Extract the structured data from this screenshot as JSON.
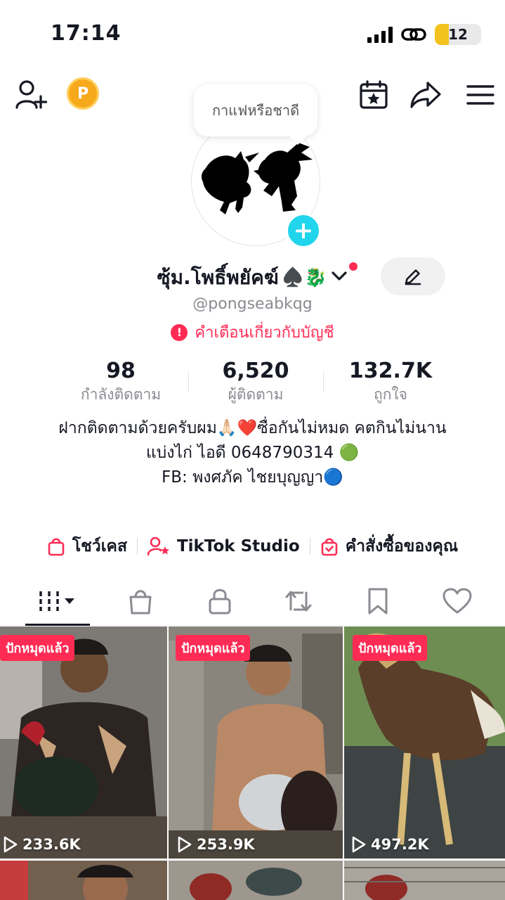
{
  "status": {
    "time": "17:14",
    "battery": "12"
  },
  "header": {
    "coin_letter": "P",
    "bubble_text": "กาแฟหรือชาดี"
  },
  "profile": {
    "display_name": "ซุ้ม.โพธิ์พยัคฆ์",
    "name_emoji": "♠️🐉",
    "username": "@pongseabkqg",
    "warning": "คำเตือนเกี่ยวกับบัญชี"
  },
  "stats": [
    {
      "value": "98",
      "label": "กำลังติดตาม"
    },
    {
      "value": "6,520",
      "label": "ผู้ติดตาม"
    },
    {
      "value": "132.7K",
      "label": "ถูกใจ"
    }
  ],
  "bio": {
    "line1": "ฝากติดตามด้วยครับผม🙏🏻❤️ซื่อกันไม่หมด คตกินไม่นาน",
    "line2": "แบ่งไก่ ไอดี 0648790314 🟢",
    "line3": "FB: พงศภัค ไชยบุญญา🔵"
  },
  "links": {
    "showcase": "โชว์เคส",
    "studio": "TikTok Studio",
    "orders": "คำสั่งซื้อของคุณ"
  },
  "videos": [
    {
      "badge": "ปักหมุดแล้ว",
      "views": "233.6K"
    },
    {
      "badge": "ปักหมุดแล้ว",
      "views": "253.9K"
    },
    {
      "badge": "ปักหมุดแล้ว",
      "views": "497.2K"
    }
  ],
  "colors": {
    "accent": "#fe2c55",
    "add_button": "#20d5ec",
    "coin": "#f7a91c"
  }
}
